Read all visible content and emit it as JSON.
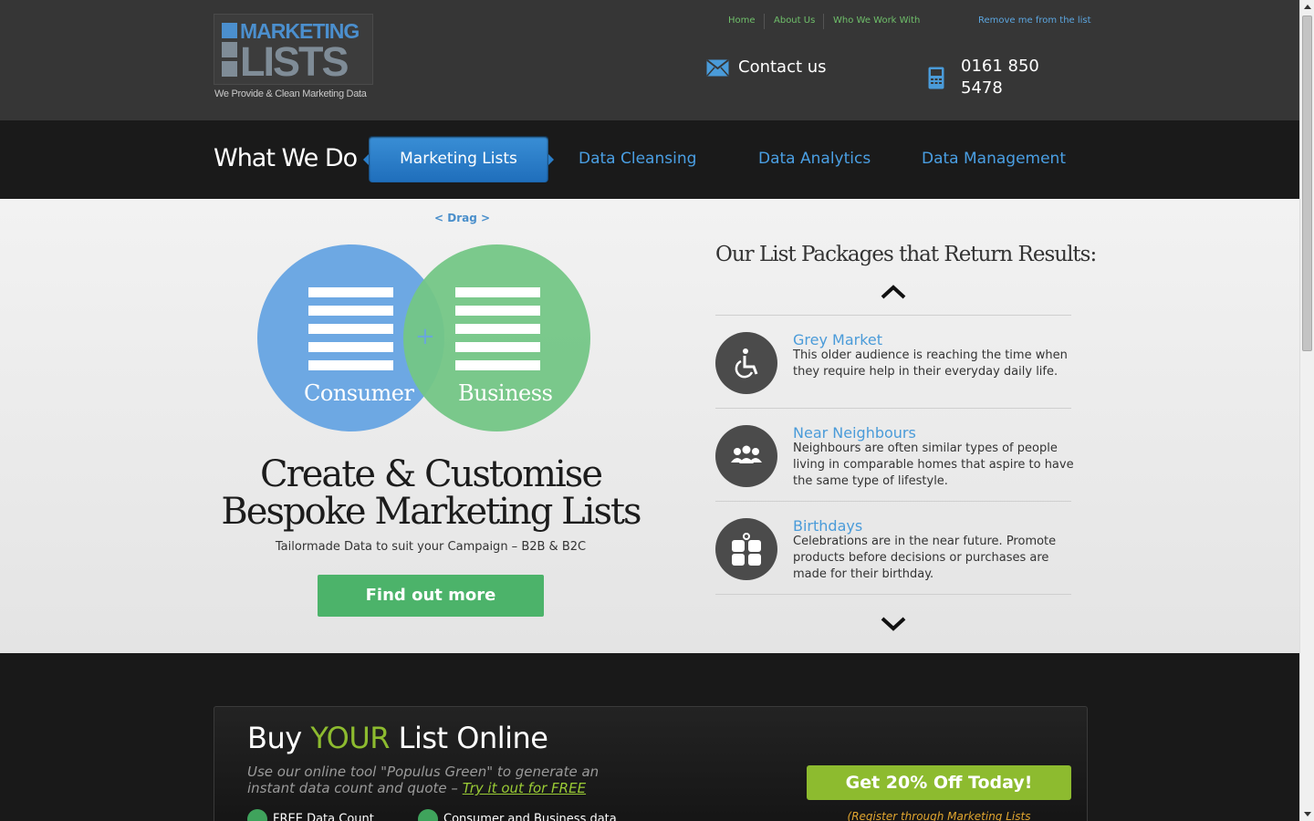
{
  "header": {
    "logo": {
      "line1": "MARKETING",
      "line2": "LISTS",
      "tagline": "We Provide & Clean Marketing Data"
    },
    "top_links": [
      {
        "label": "Home"
      },
      {
        "label": "About Us"
      },
      {
        "label": "Who We Work With"
      }
    ],
    "remove_link": "Remove me from the list",
    "contact_label": "Contact us",
    "phone": "0161 850 5478"
  },
  "nav": {
    "heading": "What We Do",
    "items": [
      {
        "label": "Marketing Lists",
        "active": true
      },
      {
        "label": "Data Cleansing"
      },
      {
        "label": "Data Analytics"
      },
      {
        "label": "Data Management"
      }
    ]
  },
  "hero": {
    "drag_hint": "< Drag >",
    "venn": {
      "left_label": "Consumer",
      "right_label": "Business",
      "center": "+"
    },
    "title": "Create & Customise Bespoke Marketing Lists",
    "subtitle": "Tailormade Data to suit your Campaign – B2B & B2C",
    "cta": "Find out more"
  },
  "packages": {
    "title": "Our List Packages that Return Results:",
    "items": [
      {
        "name": "Grey Market",
        "icon": "wheelchair-icon",
        "desc": "This older audience is reaching the time when they require help in their everyday daily life."
      },
      {
        "name": "Near Neighbours",
        "icon": "people-group-icon",
        "desc": "Neighbours are often similar types of people living in comparable homes that aspire to have the same type of lifestyle."
      },
      {
        "name": "Birthdays",
        "icon": "gift-icon",
        "desc": "Celebrations are in the near future. Promote products before decisions or purchases are made for their birthday."
      }
    ]
  },
  "buy": {
    "title_pre": "Buy ",
    "title_em": "YOUR",
    "title_post": " List Online",
    "desc": "Use our online tool \"Populus Green\" to generate an instant data count and quote – ",
    "desc_link": "Try it out for FREE",
    "features": [
      "FREE Data Count",
      "Consumer and Business data"
    ],
    "cta": "Get 20% Off Today!",
    "register": "(Register through Marketing Lists"
  },
  "colors": {
    "accent_blue": "#4a9fe3",
    "accent_green": "#4cb36a",
    "lime": "#8dbb2f",
    "header_bg": "#363636",
    "nav_bg": "#1a1a1a"
  }
}
